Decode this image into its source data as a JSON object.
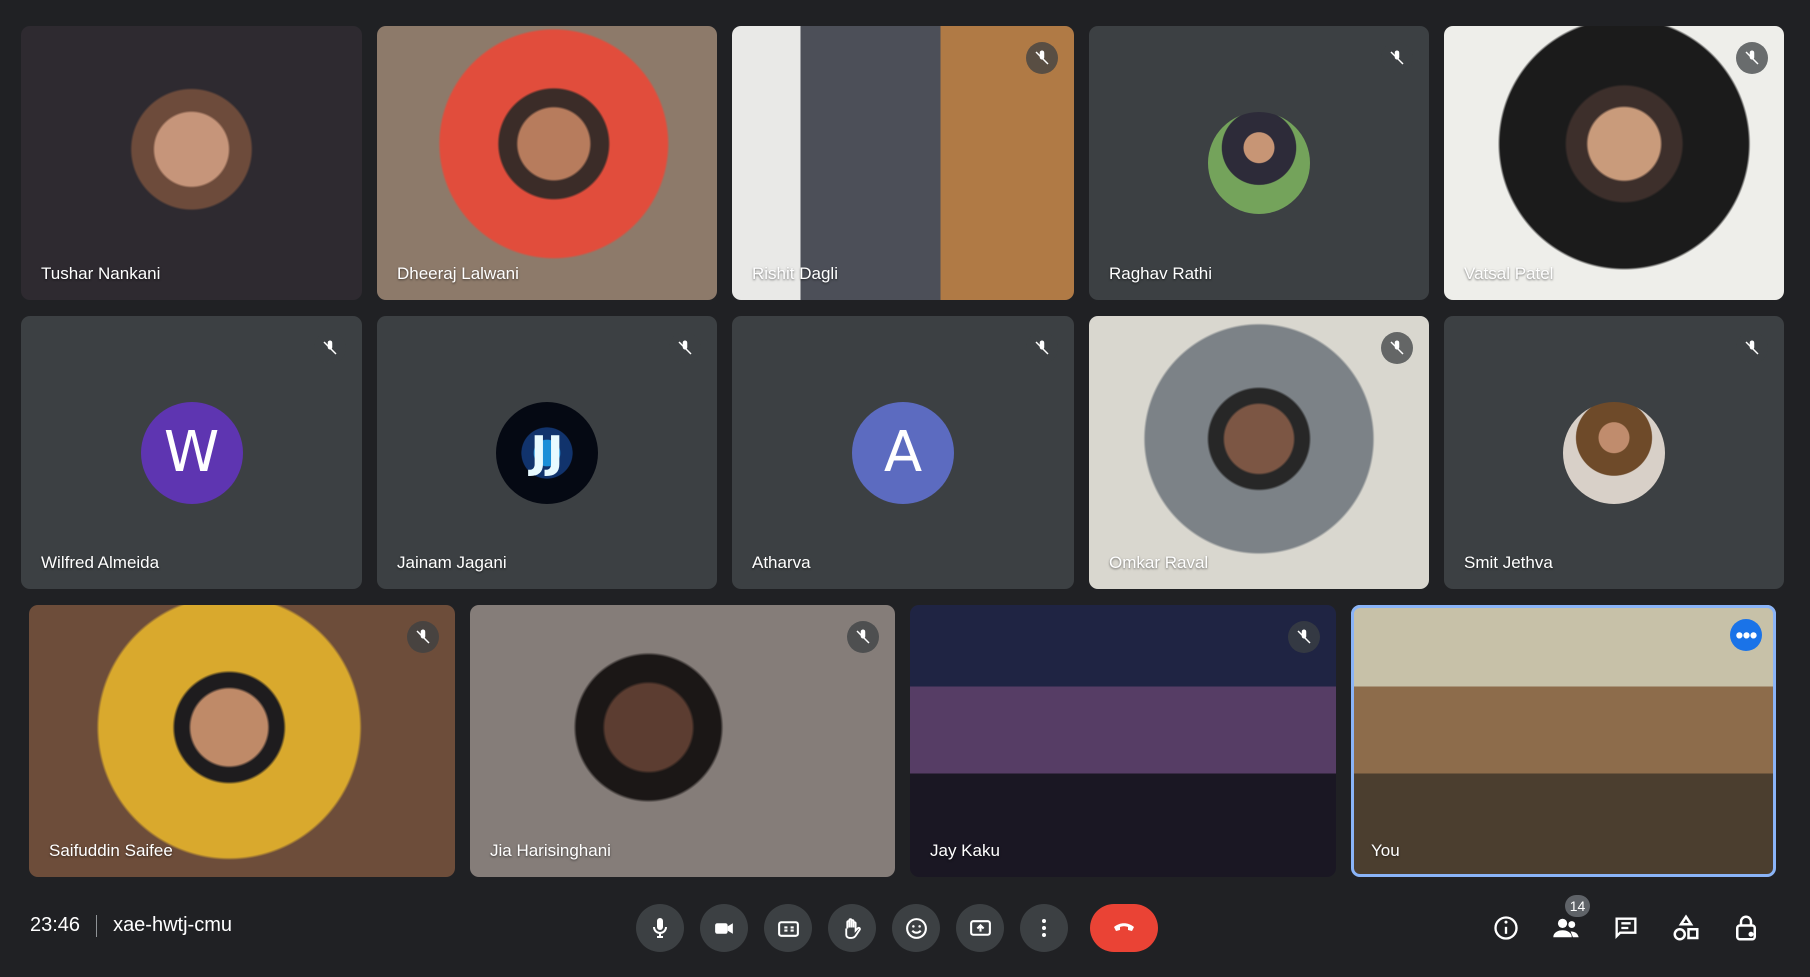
{
  "participants": [
    {
      "name": "Tushar Nankani",
      "type": "video",
      "muted": false
    },
    {
      "name": "Dheeraj Lalwani",
      "type": "video",
      "muted": false
    },
    {
      "name": "Rishit Dagli",
      "type": "video",
      "muted": true
    },
    {
      "name": "Raghav Rathi",
      "type": "photo",
      "muted": true
    },
    {
      "name": "Vatsal Patel",
      "type": "video",
      "muted": true
    },
    {
      "name": "Wilfred Almeida",
      "type": "initial",
      "initial": "W",
      "color": "#5e35b1",
      "muted": true
    },
    {
      "name": "Jainam Jagani",
      "type": "photo",
      "initial": "JJ",
      "muted": true
    },
    {
      "name": "Atharva",
      "type": "initial",
      "initial": "A",
      "color": "#5c6bc0",
      "muted": true
    },
    {
      "name": "Omkar Raval",
      "type": "video",
      "muted": true
    },
    {
      "name": "Smit Jethva",
      "type": "photo",
      "muted": true
    },
    {
      "name": "Saifuddin Saifee",
      "type": "video",
      "muted": true
    },
    {
      "name": "Jia Harisinghani",
      "type": "video",
      "muted": true
    },
    {
      "name": "Jay Kaku",
      "type": "video",
      "muted": true
    },
    {
      "name": "You",
      "type": "video",
      "muted": false,
      "highlighted": true
    }
  ],
  "meeting": {
    "time": "23:46",
    "code": "xae-hwtj-cmu"
  },
  "controls": {
    "microphone": "mic-icon",
    "camera": "camera-icon",
    "captions": "captions-icon",
    "raise_hand": "hand-icon",
    "reactions": "emoji-icon",
    "present": "present-icon",
    "more": "more-vert-icon",
    "leave": "phone-hangup-icon"
  },
  "right_actions": {
    "participant_count": "14",
    "info": "info-icon",
    "people": "people-icon",
    "chat": "chat-icon",
    "activities": "activities-icon",
    "host_controls": "lock-icon"
  },
  "colors": {
    "background": "#202124",
    "tile": "#3c4043",
    "leave": "#ea4335",
    "highlight": "#8ab4f8"
  }
}
